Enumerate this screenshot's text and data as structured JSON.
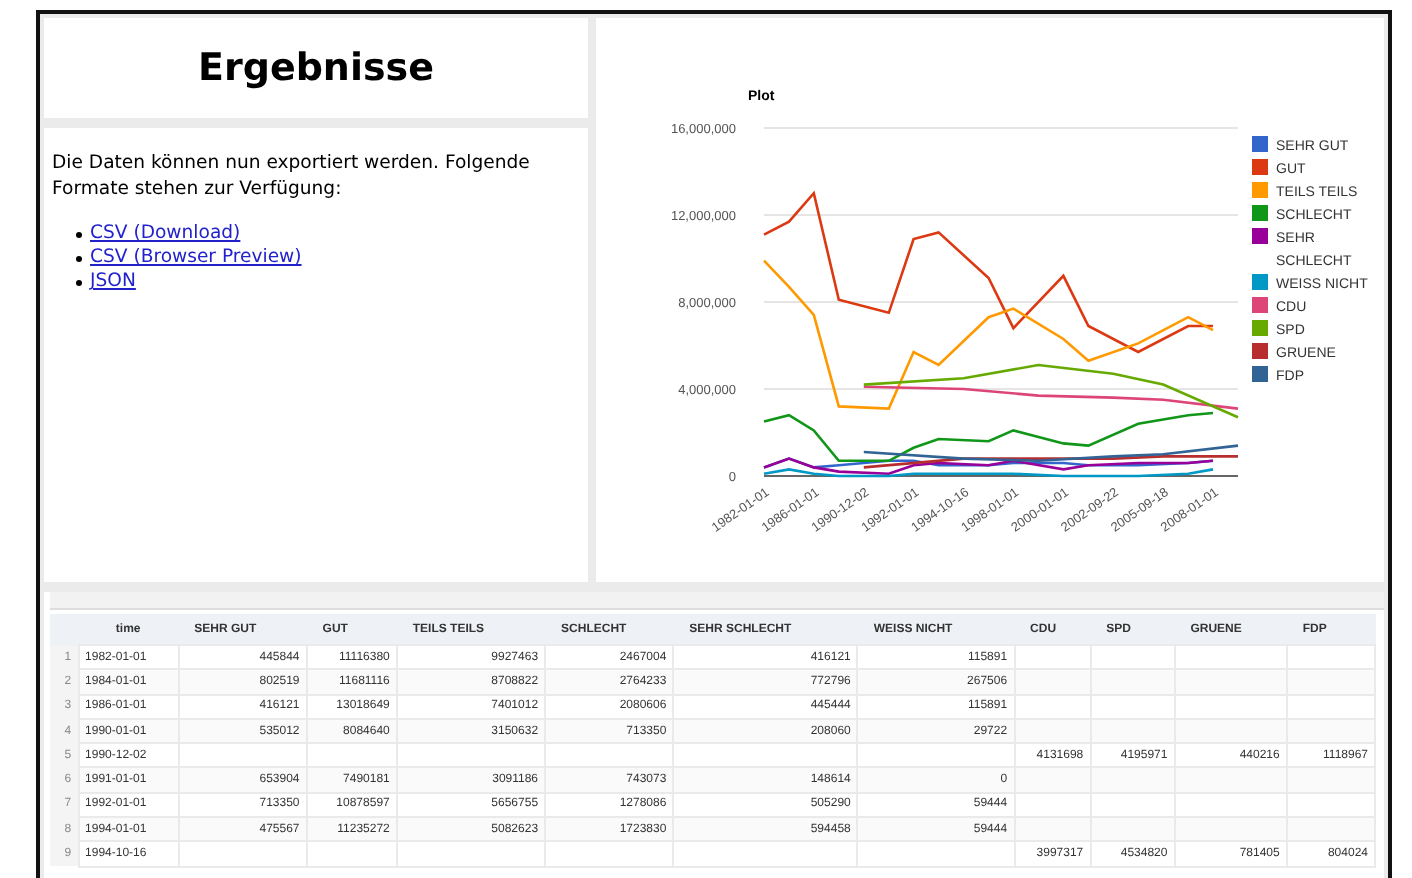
{
  "title": "Ergebnisse",
  "intro": "Die Daten können nun exportiert werden. Folgende Formate stehen zur Verfügung:",
  "links": [
    "CSV (Download)",
    "CSV (Browser Preview)",
    "JSON"
  ],
  "chart": {
    "chart_data": {
      "type": "line",
      "title": "Plot",
      "grid": true,
      "legend": true,
      "categories": [
        "1982-01-01",
        null,
        "1986-01-01",
        null,
        "1990-12-02",
        null,
        "1992-01-01",
        null,
        "1994-10-16",
        null,
        "1998-01-01",
        null,
        "2000-01-01",
        null,
        "2002-09-22",
        null,
        "2005-09-18",
        null,
        "2008-01-01",
        null
      ],
      "ylim": [
        0,
        16000000
      ],
      "yticks": [
        {
          "value": 0,
          "label": "0"
        },
        {
          "value": 4000000,
          "label": "4,000,000"
        },
        {
          "value": 8000000,
          "label": "8,000,000"
        },
        {
          "value": 12000000,
          "label": "12,000,000"
        },
        {
          "value": 16000000,
          "label": "16,000,000"
        }
      ],
      "series": [
        {
          "name": "SEHR GUT",
          "color": "#3366cc",
          "values": [
            400000,
            800000,
            400000,
            500000,
            null,
            700000,
            700000,
            500000,
            null,
            500000,
            600000,
            null,
            600000,
            500000,
            null,
            500000,
            null,
            600000,
            700000,
            null
          ]
        },
        {
          "name": "GUT",
          "color": "#dc3912",
          "values": [
            11100000,
            11700000,
            13000000,
            8100000,
            null,
            7500000,
            10900000,
            11200000,
            null,
            9100000,
            6800000,
            null,
            9200000,
            6900000,
            null,
            5700000,
            null,
            6900000,
            6900000,
            null
          ]
        },
        {
          "name": "TEILS TEILS",
          "color": "#ff9900",
          "values": [
            9900000,
            8700000,
            7400000,
            3200000,
            null,
            3100000,
            5700000,
            5100000,
            null,
            7300000,
            7700000,
            null,
            6300000,
            5300000,
            null,
            6100000,
            null,
            7300000,
            6700000,
            null
          ]
        },
        {
          "name": "SCHLECHT",
          "color": "#109618",
          "values": [
            2500000,
            2800000,
            2100000,
            700000,
            null,
            700000,
            1300000,
            1700000,
            null,
            1600000,
            2100000,
            null,
            1500000,
            1400000,
            null,
            2400000,
            null,
            2800000,
            2900000,
            null
          ]
        },
        {
          "name": "SEHR SCHLECHT",
          "color": "#990099",
          "values": [
            400000,
            800000,
            400000,
            200000,
            null,
            100000,
            500000,
            600000,
            null,
            500000,
            700000,
            null,
            300000,
            500000,
            null,
            600000,
            null,
            600000,
            700000,
            null
          ]
        },
        {
          "name": "WEISS NICHT",
          "color": "#0099c6",
          "values": [
            100000,
            300000,
            100000,
            0,
            null,
            0,
            100000,
            100000,
            null,
            100000,
            100000,
            null,
            0,
            0,
            null,
            0,
            null,
            100000,
            300000,
            null
          ]
        },
        {
          "name": "CDU",
          "color": "#dd4477",
          "values": [
            null,
            null,
            null,
            null,
            4100000,
            null,
            null,
            null,
            4000000,
            null,
            null,
            3700000,
            null,
            null,
            3600000,
            null,
            3500000,
            null,
            null,
            3100000
          ]
        },
        {
          "name": "SPD",
          "color": "#66aa00",
          "values": [
            null,
            null,
            null,
            null,
            4200000,
            null,
            null,
            null,
            4500000,
            null,
            null,
            5100000,
            null,
            null,
            4700000,
            null,
            4200000,
            null,
            null,
            2700000
          ]
        },
        {
          "name": "GRUENE",
          "color": "#b82e2e",
          "values": [
            null,
            null,
            null,
            null,
            400000,
            null,
            null,
            null,
            800000,
            null,
            null,
            800000,
            null,
            null,
            800000,
            null,
            900000,
            null,
            null,
            900000
          ]
        },
        {
          "name": "FDP",
          "color": "#316395",
          "values": [
            null,
            null,
            null,
            null,
            1100000,
            null,
            null,
            null,
            800000,
            null,
            null,
            700000,
            null,
            null,
            900000,
            null,
            1000000,
            null,
            null,
            1400000
          ]
        }
      ]
    }
  },
  "table": {
    "columns": [
      "time",
      "SEHR GUT",
      "GUT",
      "TEILS TEILS",
      "SCHLECHT",
      "SEHR SCHLECHT",
      "WEISS NICHT",
      "CDU",
      "SPD",
      "GRUENE",
      "FDP"
    ],
    "rows": [
      {
        "number": "1",
        "cells": [
          "1982-01-01",
          "445844",
          "11116380",
          "9927463",
          "2467004",
          "416121",
          "115891",
          "",
          "",
          "",
          ""
        ]
      },
      {
        "number": "2",
        "cells": [
          "1984-01-01",
          "802519",
          "11681116",
          "8708822",
          "2764233",
          "772796",
          "267506",
          "",
          "",
          "",
          ""
        ]
      },
      {
        "number": "3",
        "cells": [
          "1986-01-01",
          "416121",
          "13018649",
          "7401012",
          "2080606",
          "445444",
          "115891",
          "",
          "",
          "",
          ""
        ]
      },
      {
        "number": "4",
        "cells": [
          "1990-01-01",
          "535012",
          "8084640",
          "3150632",
          "713350",
          "208060",
          "29722",
          "",
          "",
          "",
          ""
        ]
      },
      {
        "number": "5",
        "cells": [
          "1990-12-02",
          "",
          "",
          "",
          "",
          "",
          "",
          "4131698",
          "4195971",
          "440216",
          "1118967"
        ]
      },
      {
        "number": "6",
        "cells": [
          "1991-01-01",
          "653904",
          "7490181",
          "3091186",
          "743073",
          "148614",
          "0",
          "",
          "",
          "",
          ""
        ]
      },
      {
        "number": "7",
        "cells": [
          "1992-01-01",
          "713350",
          "10878597",
          "5656755",
          "1278086",
          "505290",
          "59444",
          "",
          "",
          "",
          ""
        ]
      },
      {
        "number": "8",
        "cells": [
          "1994-01-01",
          "475567",
          "11235272",
          "5082623",
          "1723830",
          "594458",
          "59444",
          "",
          "",
          "",
          ""
        ]
      },
      {
        "number": "9",
        "cells": [
          "1994-10-16",
          "",
          "",
          "",
          "",
          "",
          "",
          "3997317",
          "4534820",
          "781405",
          "804024"
        ]
      }
    ]
  }
}
